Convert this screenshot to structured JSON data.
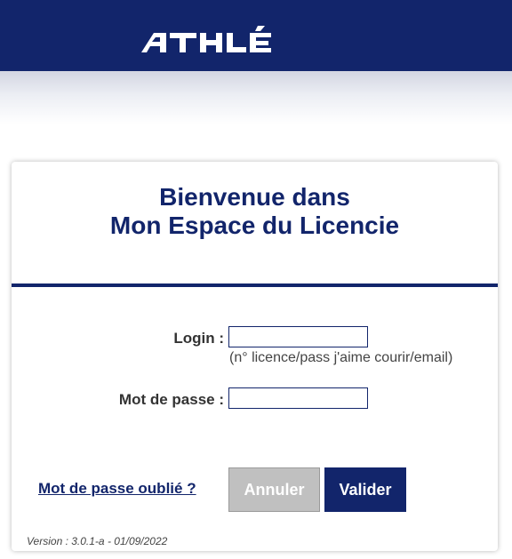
{
  "header": {
    "logo_text": "ATHLÉ",
    "color": "#12256b"
  },
  "card": {
    "title_line1": "Bienvenue dans",
    "title_line2": "Mon Espace du Licencie"
  },
  "form": {
    "login_label": "Login :",
    "login_value": "",
    "login_hint": "(n° licence/pass j'aime courir/email)",
    "password_label": "Mot de passe :",
    "password_value": ""
  },
  "actions": {
    "forgot_link": "Mot de passe oublié ?",
    "cancel_label": "Annuler",
    "submit_label": "Valider"
  },
  "footer": {
    "version": "Version : 3.0.1-a - 01/09/2022"
  }
}
